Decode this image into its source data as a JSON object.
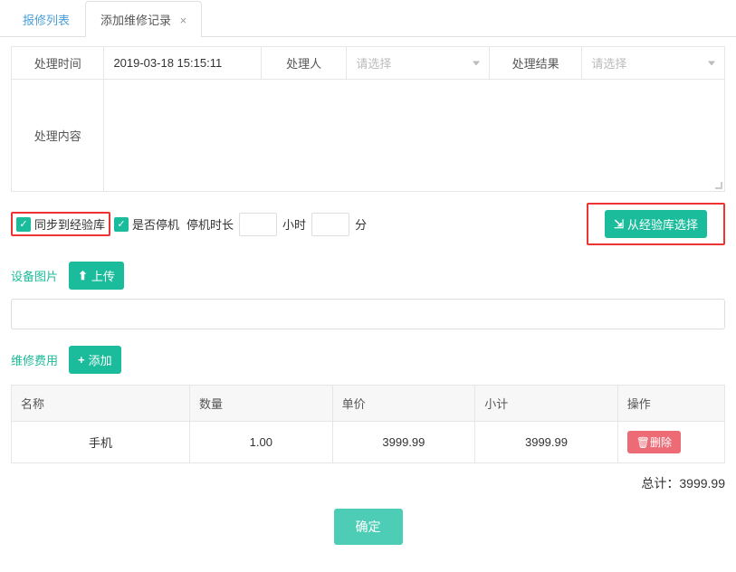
{
  "tabs": {
    "inactive": "报修列表",
    "active": "添加维修记录",
    "close": "×"
  },
  "form": {
    "time_label": "处理时间",
    "time_value": "2019-03-18 15:15:11",
    "handler_label": "处理人",
    "handler_placeholder": "请选择",
    "result_label": "处理结果",
    "result_placeholder": "请选择",
    "content_label": "处理内容"
  },
  "checkboxes": {
    "sync_label": "同步到经验库",
    "downtime_label": "是否停机",
    "downtime_text": "停机时长",
    "hour_label": "小时",
    "minute_label": "分"
  },
  "buttons": {
    "from_experience": "从经验库选择",
    "upload": "上传",
    "add": "添加",
    "delete": "删除",
    "confirm": "确定"
  },
  "sections": {
    "images": "设备图片",
    "cost": "维修费用"
  },
  "cost_table": {
    "headers": {
      "name": "名称",
      "qty": "数量",
      "price": "单价",
      "subtotal": "小计",
      "action": "操作"
    },
    "rows": [
      {
        "name": "手机",
        "qty": "1.00",
        "price": "3999.99",
        "subtotal": "3999.99"
      }
    ]
  },
  "total": {
    "label": "总计：",
    "value": "3999.99"
  },
  "icons": {
    "check": "✓",
    "plus": "+",
    "upload_icon": "⬆",
    "import_icon": "⇲",
    "trash": "🗑"
  }
}
